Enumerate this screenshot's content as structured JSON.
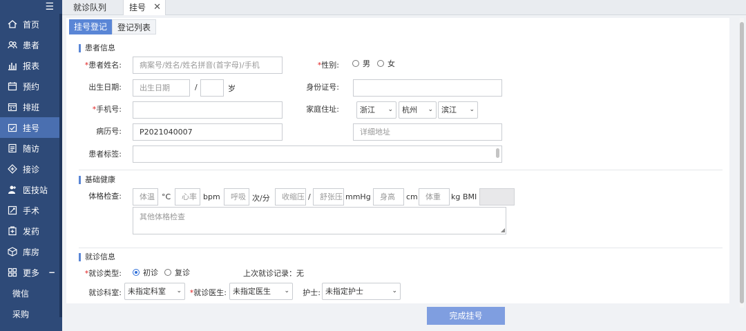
{
  "sidebar": {
    "menu_icon": "hamburger-icon",
    "items": [
      {
        "label": "首页",
        "icon": "home-icon"
      },
      {
        "label": "患者",
        "icon": "patients-icon"
      },
      {
        "label": "报表",
        "icon": "bar-chart-icon"
      },
      {
        "label": "预约",
        "icon": "calendar-icon"
      },
      {
        "label": "排班",
        "icon": "schedule-icon"
      },
      {
        "label": "挂号",
        "icon": "register-icon",
        "active": true
      },
      {
        "label": "随访",
        "icon": "followup-icon"
      },
      {
        "label": "接诊",
        "icon": "consult-icon"
      },
      {
        "label": "医技站",
        "icon": "medtech-icon"
      },
      {
        "label": "手术",
        "icon": "surgery-icon"
      },
      {
        "label": "发药",
        "icon": "dispense-icon"
      },
      {
        "label": "库房",
        "icon": "warehouse-icon"
      },
      {
        "label": "更多",
        "icon": "more-icon",
        "toggle": "−"
      }
    ],
    "sub_items": [
      "微信",
      "采购"
    ]
  },
  "tabs": {
    "queue": "就诊队列",
    "register": "挂号",
    "close": "✕"
  },
  "subtabs": {
    "register": "挂号登记",
    "list": "登记列表"
  },
  "patient": {
    "title": "患者信息",
    "name_label": "患者姓名:",
    "name_placeholder": "病案号/姓名/姓名拼音(首字母)/手机",
    "gender_label": "性别:",
    "gender_male": "男",
    "gender_female": "女",
    "dob_label": "出生日期:",
    "dob_placeholder": "出生日期",
    "dob_slash": "/",
    "age_unit": "岁",
    "id_label": "身份证号:",
    "phone_label": "手机号:",
    "address_label": "家庭住址:",
    "province": "浙江",
    "city": "杭州",
    "district": "滨江",
    "record_label": "病历号:",
    "record_value": "P2021040007",
    "address_detail_placeholder": "详细地址",
    "tags_label": "患者标签:"
  },
  "health": {
    "title": "基础健康",
    "exam_label": "体格检查:",
    "temp_placeholder": "体温",
    "temp_unit": "°C",
    "heart_placeholder": "心率",
    "heart_unit": "bpm",
    "breath_placeholder": "呼吸",
    "breath_unit": "次/分",
    "systolic_placeholder": "收缩压",
    "slash": "/",
    "diastolic_placeholder": "舒张压",
    "bp_unit": "mmHg",
    "height_placeholder": "身高",
    "height_unit": "cm",
    "weight_placeholder": "体重",
    "weight_unit": "kg",
    "bmi_label": "BMI",
    "other_placeholder": "其他体格检查"
  },
  "visit": {
    "title": "就诊信息",
    "type_label": "就诊类型:",
    "type_first": "初诊",
    "type_return": "复诊",
    "last_record": "上次就诊记录：无",
    "dept_label": "就诊科室:",
    "dept_value": "未指定科室",
    "doctor_label": "就诊医生:",
    "doctor_value": "未指定医生",
    "nurse_label": "护士:",
    "nurse_value": "未指定护士"
  },
  "required_mark": "*",
  "dropdown_caret": "⌄",
  "submit_label": "完成挂号",
  "colors": {
    "sidebar": "#2e4a78",
    "sidebar_active": "#4a6fb0",
    "accent": "#5a86d6",
    "submit": "#7f9ee0",
    "required": "#e02020"
  }
}
